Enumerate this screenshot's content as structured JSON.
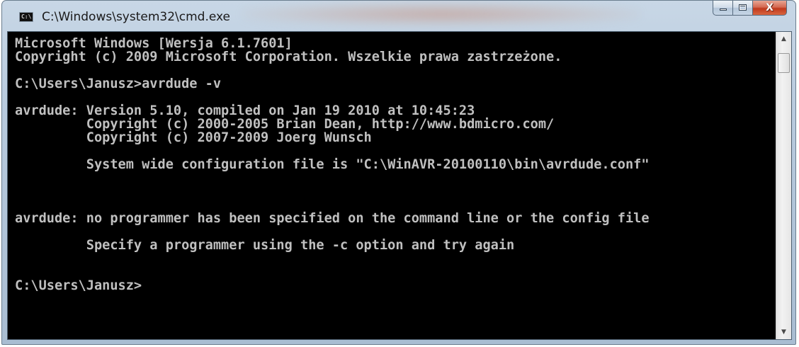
{
  "window": {
    "title": "C:\\Windows\\system32\\cmd.exe",
    "icon": "cmd-icon",
    "icon_text": "C:\\",
    "controls": {
      "minimize": "minimize-icon",
      "maximize": "maximize-icon",
      "close_label": "X"
    }
  },
  "console": {
    "lines": [
      "Microsoft Windows [Wersja 6.1.7601]",
      "Copyright (c) 2009 Microsoft Corporation. Wszelkie prawa zastrzeżone.",
      "",
      "C:\\Users\\Janusz>avrdude -v",
      "",
      "avrdude: Version 5.10, compiled on Jan 19 2010 at 10:45:23",
      "         Copyright (c) 2000-2005 Brian Dean, http://www.bdmicro.com/",
      "         Copyright (c) 2007-2009 Joerg Wunsch",
      "",
      "         System wide configuration file is \"C:\\WinAVR-20100110\\bin\\avrdude.conf\"",
      "",
      "",
      "",
      "avrdude: no programmer has been specified on the command line or the config file",
      "",
      "         Specify a programmer using the -c option and try again",
      "",
      "",
      "C:\\Users\\Janusz>"
    ]
  },
  "scrollbar": {
    "up_arrow": "▲",
    "down_arrow": "▼"
  }
}
